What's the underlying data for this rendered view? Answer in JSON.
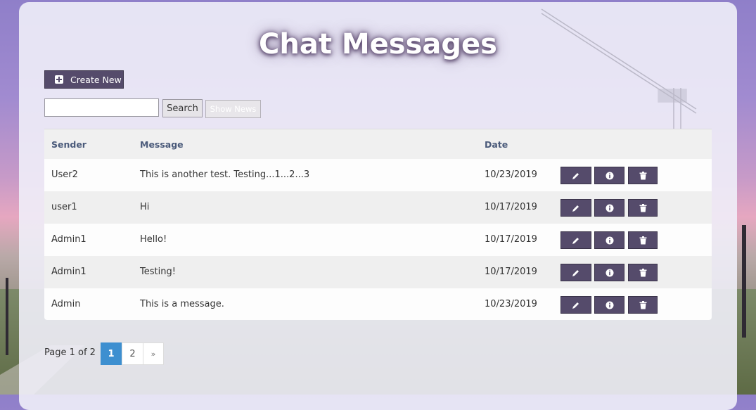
{
  "page": {
    "title": "Chat Messages"
  },
  "toolbar": {
    "create_label": "Create New",
    "search_value": "",
    "search_label": "Search",
    "show_news_label": "Show News"
  },
  "table": {
    "headers": [
      "Sender",
      "Message",
      "Date"
    ],
    "rows": [
      {
        "sender": "User2",
        "message": "This is another test. Testing...1...2...3",
        "date": "10/23/2019"
      },
      {
        "sender": "user1",
        "message": "Hi",
        "date": "10/17/2019"
      },
      {
        "sender": "Admin1",
        "message": "Hello!",
        "date": "10/17/2019"
      },
      {
        "sender": "Admin1",
        "message": "Testing!",
        "date": "10/17/2019"
      },
      {
        "sender": "Admin",
        "message": "This is a message.",
        "date": "10/23/2019"
      }
    ],
    "row_actions": [
      "pencil-icon",
      "info-icon",
      "trash-icon"
    ]
  },
  "pagination": {
    "label": "Page 1 of 2",
    "pages": [
      "1",
      "2"
    ],
    "next": "»",
    "current": "1"
  },
  "colors": {
    "accent": "#554b6b",
    "active_page": "#3d8fd0",
    "header_text": "#4a5a7a"
  }
}
